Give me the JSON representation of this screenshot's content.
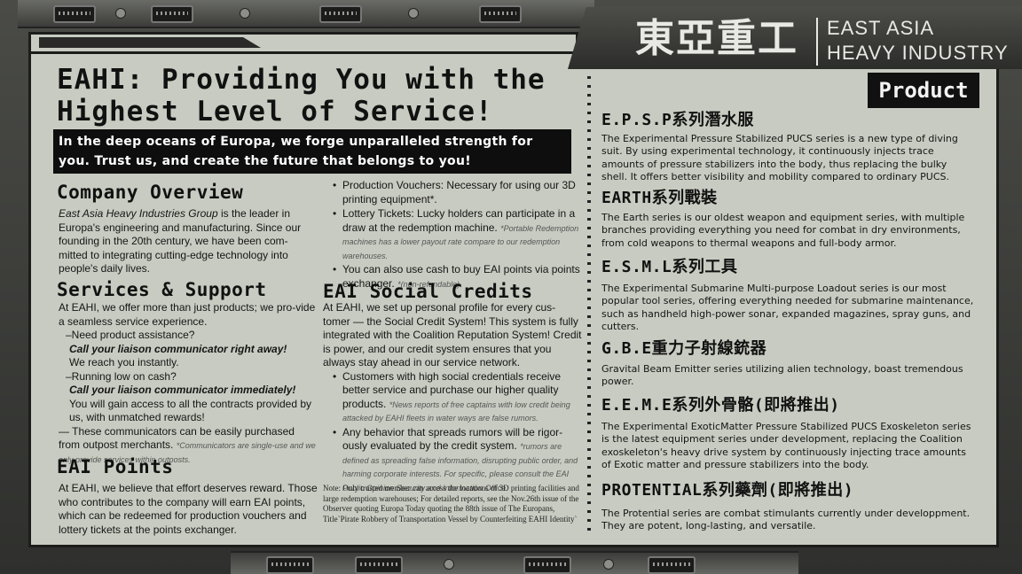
{
  "brand": {
    "logo_cn": "東亞重工",
    "logo_en_line1": "EAST ASIA",
    "logo_en_line2": "HEAVY INDUSTRY"
  },
  "tag": "Product",
  "headline": {
    "line1": "EAHI: Providing You with the",
    "line2": "Highest Level of Service!"
  },
  "banner": "In the deep oceans of Europa, we forge unparalleled strength for you. Trust us, and create the future that belongs to you!",
  "overview": {
    "title": "Company Overview",
    "em": "East Asia Heavy Industries Group",
    "text": " is the leader in Europa's engineering and manufacturing. Since our founding in the 20th century, we have been com-mitted to integrating cutting-edge technology into people's daily lives."
  },
  "services": {
    "title": "Services & Support",
    "intro": "At EAHI, we offer more than just products; we pro-vide a seamless service experience.",
    "q1": "–Need product assistance?",
    "a1_strong": "Call your liaison communicator right away!",
    "a1": "We reach you instantly.",
    "q2": "–Running low on cash?",
    "a2_strong": "Call your liaison communicator immediately!",
    "a2": "You will gain access to all the contracts provided by us, with unmatched rewards!",
    "tail": "— These communicators can be easily purchased from outpost merchants.",
    "tail_note": "*Communicators are single-use and we only provide services within outposts."
  },
  "points": {
    "title": "EAI Points",
    "text": "At EAHI, we believe that effort deserves reward. Those who contributes to the company will earn EAI points, which can be redeemed for production vouchers and lottery tickets at the points exchanger."
  },
  "vouchers": {
    "item1": "Production Vouchers: Necessary for using our 3D printing equipment*.",
    "item2": "Lottery Tickets: Lucky holders can participate in a draw at the redemption machine.",
    "item2_note": "*Portable Redemption machines has a lower payout rate compare to our redemption warehouses.",
    "item3": "You can also use cash to buy EAI points via points exchanger.",
    "item3_note": "*(non-refundable)"
  },
  "credits": {
    "title": "EAI Social Credits",
    "text": "At EAHI, we set up personal profile for every cus-tomer — the Social Credit System! This system is fully integrated with the Coalition Reputation System! Credit is power, and our credit system ensures that you always stay ahead in our service network.",
    "item1": "Customers with high social credentials receive better service and purchase our higher quality products.",
    "item1_note": "*News reports of free captains with low credit being attacked by EAHI fleets in water ways are false rumors.",
    "item2": "Any behavior that spreads rumors will be rigor-ously evaluated by the credit system.",
    "item2_note": "*rumors are defined as spreading false information, disrupting public order, and harming corporate interests. For specific, please consult the EAI Public Opinion Security and Information Office."
  },
  "footnote": "Note: Only trusted member can access the locations of 3D printing facilities and large redemption warehouses; For detailed reports, see the Nov.26th issue of the Observer quoting Europa Today quoting the 88th issue of The Europans, Title`Pirate Robbery of Transportation Vessel by Counterfeiting EAHI Identity`",
  "products": [
    {
      "title": "E.P.S.P系列潛水服",
      "desc": "The Experimental Pressure Stabilized PUCS series is a new type of diving suit. By using experimental technology, it continuously injects trace amounts of pressure stabilizers into the body, thus replacing the bulky shell. It offers better visibility and mobility compared to ordinary PUCS."
    },
    {
      "title": "EARTH系列戰裝",
      "desc": "The Earth series is our oldest weapon and equipment series, with multiple branches providing everything you need for combat in dry environments, from cold weapons to thermal weapons and full-body armor."
    },
    {
      "title": "E.S.M.L系列工具",
      "desc": "The Experimental Submarine Multi-purpose Loadout series is our most popular tool series, offering everything needed for submarine maintenance, such as handheld high-power sonar, expanded magazines, spray guns, and cutters."
    },
    {
      "title": "G.B.E重力子射線銃器",
      "desc": "Gravital Beam Emitter series utilizing alien technology, boast tremendous power."
    },
    {
      "title": "E.E.M.E系列外骨骼(即將推出)",
      "desc": "The Experimental ExoticMatter Pressure Stabilized PUCS Exoskeleton series is the latest equipment series under development, replacing the Coalition exoskeleton's heavy drive system by continuously injecting trace amounts of Exotic matter and pressure stabilizers into the body."
    },
    {
      "title": "PROTENTIAL系列藥劑(即將推出)",
      "desc": "The Protential series are combat stimulants currently under developpment. They are potent, long-lasting, and versatile."
    }
  ]
}
